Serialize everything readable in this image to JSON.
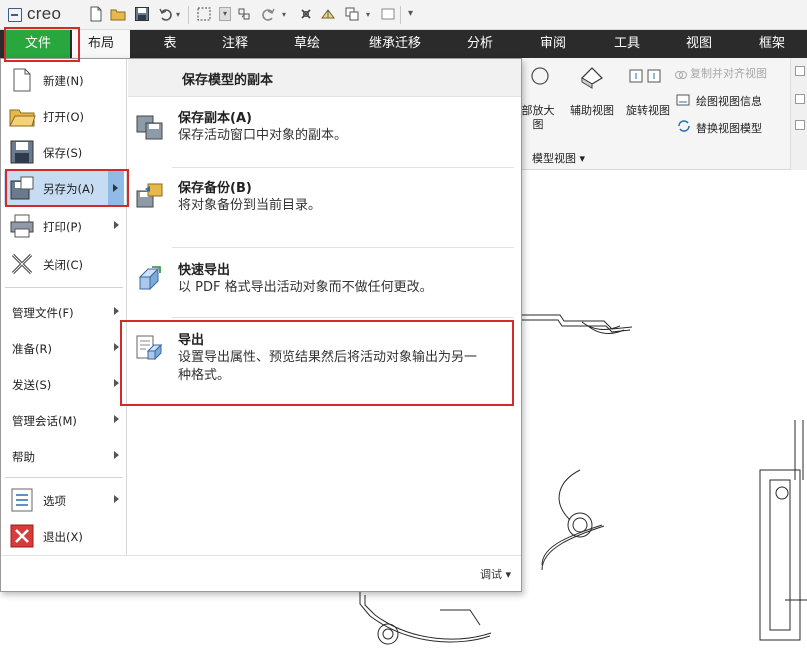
{
  "app": {
    "logo_text": "creo"
  },
  "tabs": [
    "文件",
    "布局",
    "表",
    "注释",
    "草绘",
    "继承迁移",
    "分析",
    "审阅",
    "工具",
    "视图",
    "框架"
  ],
  "ribbon": {
    "buttons": [
      "部放大图",
      "辅助视图",
      "旋转视图"
    ],
    "small_items": [
      {
        "label": "复制并对齐视图",
        "disabled": true
      },
      {
        "label": "绘图视图信息",
        "disabled": false
      },
      {
        "label": "替换视图模型",
        "disabled": false
      }
    ],
    "group_label": "模型视图 ▾"
  },
  "file_menu": {
    "items": [
      {
        "label": "新建(N)",
        "icon": "new-file-icon"
      },
      {
        "label": "打开(O)",
        "icon": "open-folder-icon"
      },
      {
        "label": "保存(S)",
        "icon": "save-icon"
      },
      {
        "label": "另存为(A)",
        "icon": "save-as-icon",
        "selected": true
      },
      {
        "label": "打印(P)",
        "icon": "print-icon"
      },
      {
        "label": "关闭(C)",
        "icon": "close-icon"
      }
    ],
    "text_items": [
      "管理文件(F)",
      "准备(R)",
      "发送(S)",
      "管理会话(M)",
      "帮助"
    ],
    "bottom_items": [
      {
        "label": "选项",
        "icon": "options-icon"
      },
      {
        "label": "退出(X)",
        "icon": "exit-icon"
      }
    ],
    "submenu": {
      "title": "保存模型的副本",
      "items": [
        {
          "title": "保存副本(A)",
          "desc": "保存活动窗口中对象的副本。",
          "icon": "save-copy-icon"
        },
        {
          "title": "保存备份(B)",
          "desc": "将对象备份到当前目录。",
          "icon": "save-backup-icon"
        },
        {
          "title": "快速导出",
          "desc": "以 PDF 格式导出活动对象而不做任何更改。",
          "icon": "quick-export-icon"
        },
        {
          "title": "导出",
          "desc": "设置导出属性、预览结果然后将活动对象输出为另一种格式。",
          "icon": "export-icon"
        }
      ]
    },
    "footer_label": "调试 ▾"
  },
  "colors": {
    "file_tab": "#27a73d",
    "tab_bar": "#2b2b2b",
    "selection": "#c6dcf2",
    "highlight": "#d42a2a"
  }
}
